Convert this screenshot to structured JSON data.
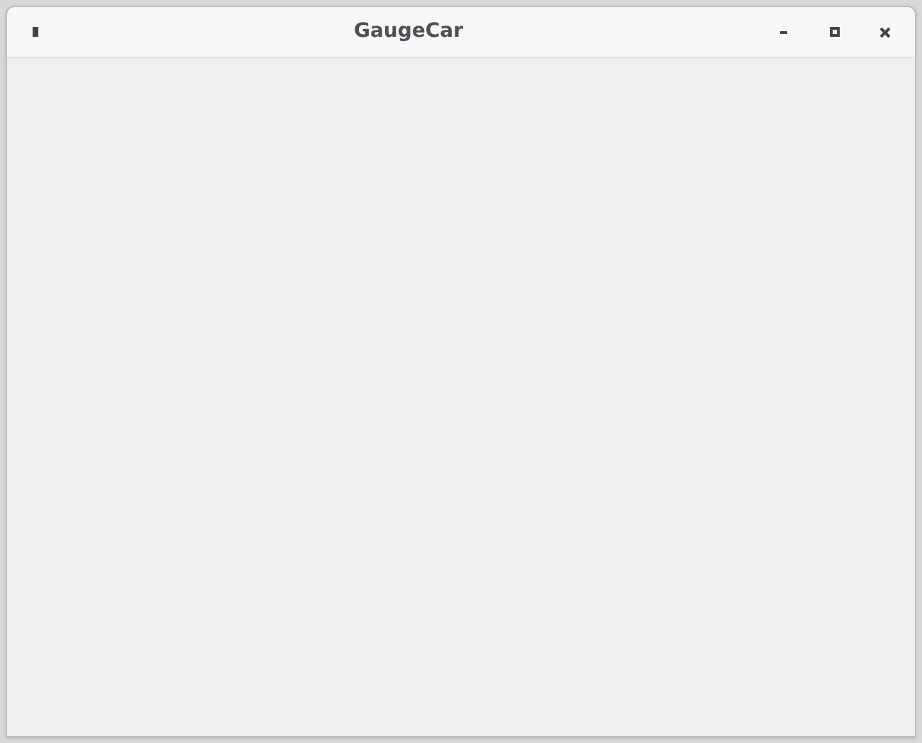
{
  "window": {
    "title": "GaugeCar"
  }
}
